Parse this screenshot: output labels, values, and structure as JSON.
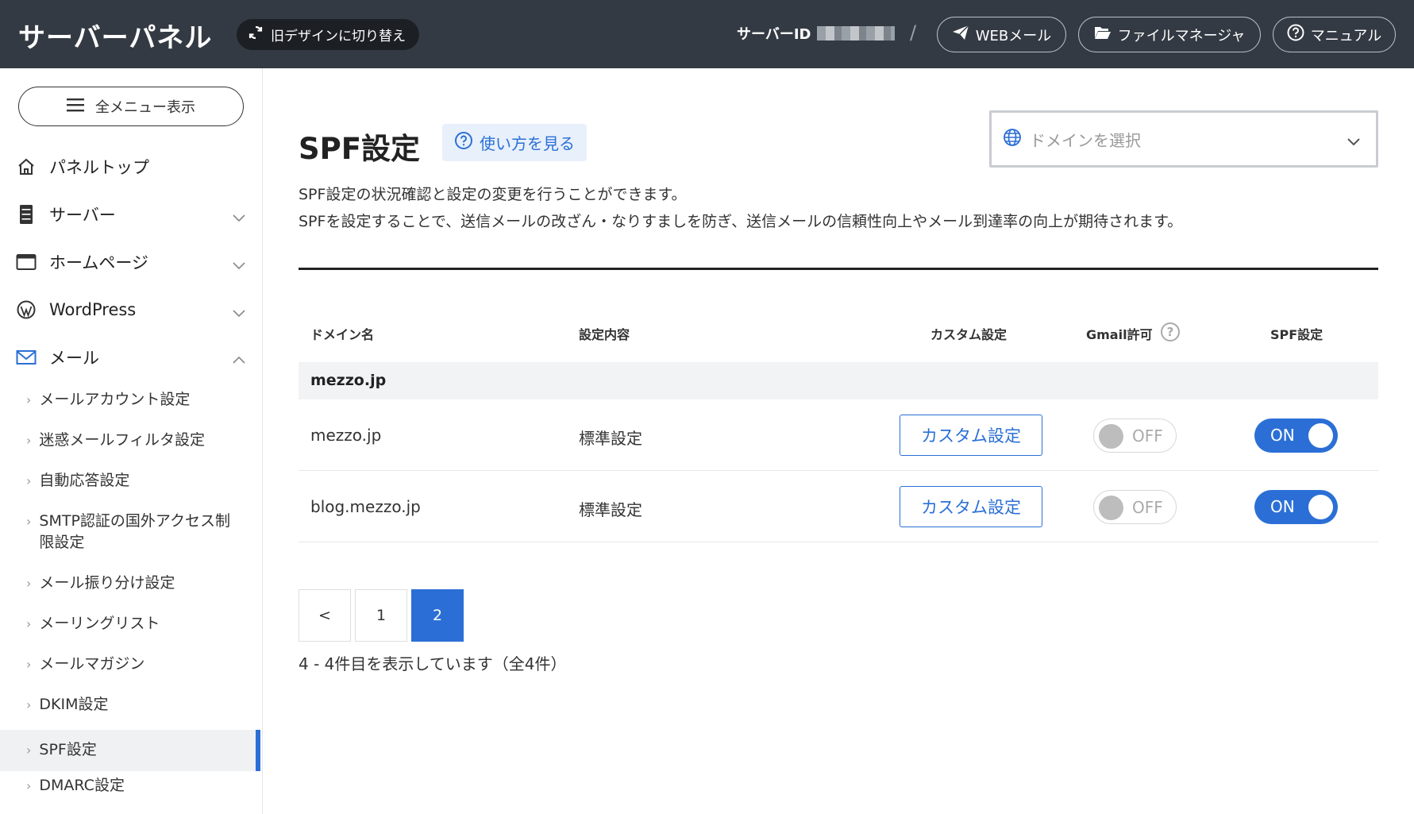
{
  "header": {
    "brand": "サーバーパネル",
    "switch_label": "旧デザインに切り替え",
    "server_id_label": "サーバーID",
    "separator": "/",
    "webmail_label": "WEBメール",
    "filemanager_label": "ファイルマネージャ",
    "manual_label": "マニュアル"
  },
  "sidebar": {
    "all_menu_label": "全メニュー表示",
    "items": [
      {
        "label": "パネルトップ"
      },
      {
        "label": "サーバー"
      },
      {
        "label": "ホームページ"
      },
      {
        "label": "WordPress"
      },
      {
        "label": "メール"
      }
    ],
    "mail_sub": [
      {
        "label": "メールアカウント設定"
      },
      {
        "label": "迷惑メールフィルタ設定"
      },
      {
        "label": "自動応答設定"
      },
      {
        "label": "SMTP認証の国外アクセス制",
        "label2": "限設定"
      },
      {
        "label": "メール振り分け設定"
      },
      {
        "label": "メーリングリスト"
      },
      {
        "label": "メールマガジン"
      },
      {
        "label": "DKIM設定"
      },
      {
        "label": "SPF設定"
      },
      {
        "label": "DMARC設定"
      }
    ]
  },
  "main": {
    "title": "SPF設定",
    "howto_label": "使い方を見る",
    "domain_select_placeholder": "ドメインを選択",
    "description_line1": "SPF設定の状況確認と設定の変更を行うことができます。",
    "description_line2": "SPFを設定することで、送信メールの改ざん・なりすましを防ぎ、送信メールの信頼性向上やメール到達率の向上が期待されます。",
    "table": {
      "headers": [
        "ドメイン名",
        "設定内容",
        "カスタム設定",
        "Gmail許可",
        "SPF設定"
      ],
      "help_glyph": "?",
      "group": "mezzo.jp",
      "rows": [
        {
          "domain": "mezzo.jp",
          "setting": "標準設定",
          "custom_label": "カスタム設定",
          "gmail": "OFF",
          "spf": "ON"
        },
        {
          "domain": "blog.mezzo.jp",
          "setting": "標準設定",
          "custom_label": "カスタム設定",
          "gmail": "OFF",
          "spf": "ON"
        }
      ]
    },
    "pagination": {
      "prev": "<",
      "pages": [
        "1",
        "2"
      ],
      "current": "2"
    },
    "count_text": "4 - 4件目を表示しています（全4件）"
  },
  "colors": {
    "header_bg": "#343a43",
    "accent": "#2b6fd6"
  }
}
